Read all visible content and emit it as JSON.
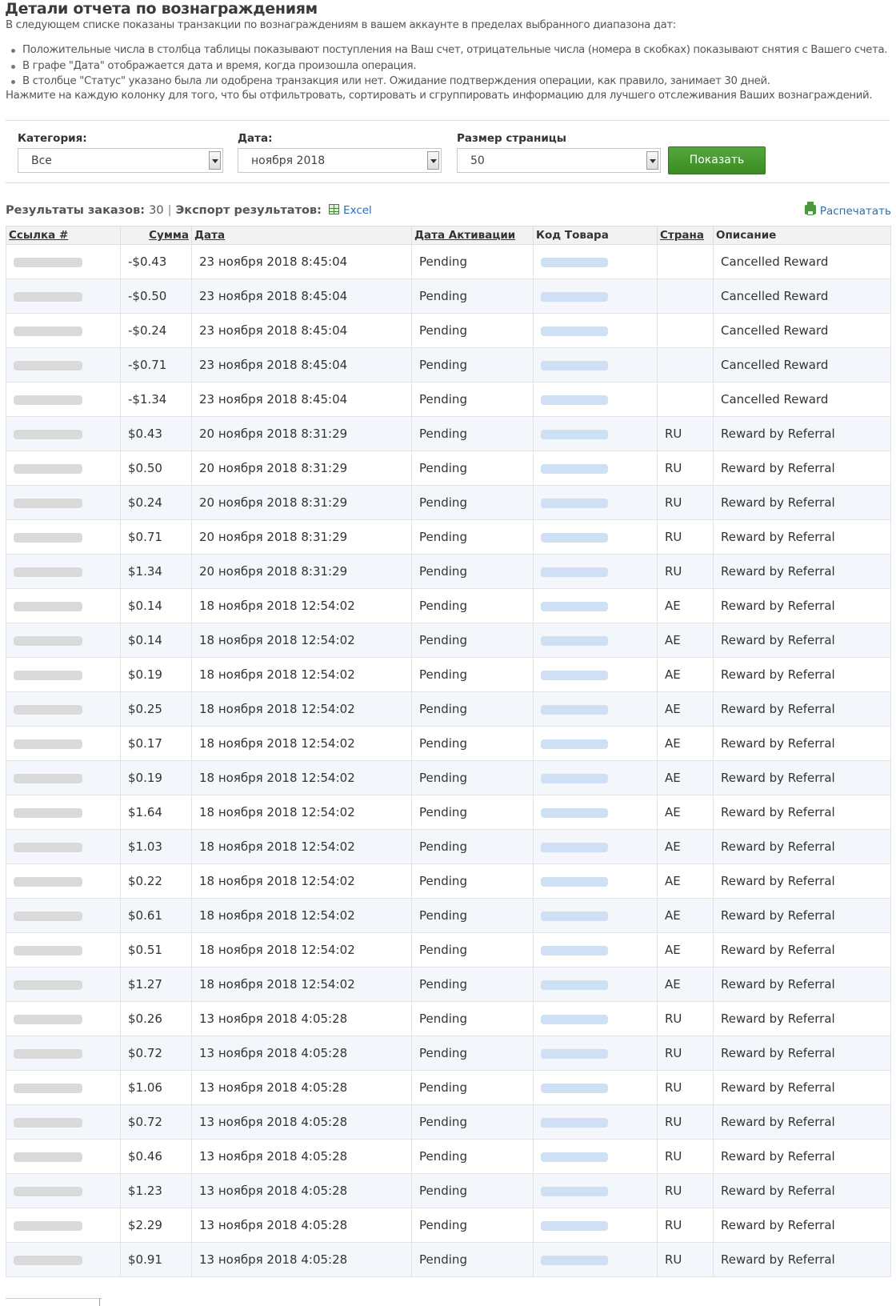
{
  "title": "Детали отчета по вознаграждениям",
  "intro": "В следующем списке показаны транзакции по вознаграждениям в вашем аккаунте в пределах выбранного диапазона дат:",
  "bullets": [
    "Положительные числа в столбца таблицы показывают поступления на Ваш счет, отрицательные числа (номера в скобках) показывают снятия с Вашего счета.",
    "В графе \"Дата\" отображается дата и время, когда произошла операция.",
    "В столбце \"Статус\" указано была ли одобрена транзакция или нет. Ожидание подтверждения операции, как правило, занимает 30 дней."
  ],
  "note": "Нажмите на каждую колонку для того, что бы отфильтровать, сортировать и сгруппировать информацию для лучшего отслеживания Ваших вознаграждений.",
  "filters": {
    "category_label": "Категория:",
    "category_value": "Все",
    "date_label": "Дата:",
    "date_value": "ноября 2018",
    "page_size_label": "Размер страницы",
    "page_size_value": "50",
    "show_button": "Показать"
  },
  "results": {
    "label": "Результаты заказов:",
    "count": "30",
    "separator": "|",
    "export_label": "Экспорт результатов:",
    "excel_link": "Excel",
    "print_link": "Распечатать"
  },
  "table": {
    "headers": {
      "ref": "Ссылка #",
      "amount": "Сумма",
      "date": "Дата",
      "activation": "Дата Активации",
      "product": "Код Товара",
      "country": "Страна",
      "description": "Описание"
    },
    "rows": [
      {
        "amount": "-$0.43",
        "date": "23 ноября 2018 8:45:04",
        "status": "Pending",
        "country": "",
        "desc": "Cancelled Reward"
      },
      {
        "amount": "-$0.50",
        "date": "23 ноября 2018 8:45:04",
        "status": "Pending",
        "country": "",
        "desc": "Cancelled Reward"
      },
      {
        "amount": "-$0.24",
        "date": "23 ноября 2018 8:45:04",
        "status": "Pending",
        "country": "",
        "desc": "Cancelled Reward"
      },
      {
        "amount": "-$0.71",
        "date": "23 ноября 2018 8:45:04",
        "status": "Pending",
        "country": "",
        "desc": "Cancelled Reward"
      },
      {
        "amount": "-$1.34",
        "date": "23 ноября 2018 8:45:04",
        "status": "Pending",
        "country": "",
        "desc": "Cancelled Reward"
      },
      {
        "amount": "$0.43",
        "date": "20 ноября 2018 8:31:29",
        "status": "Pending",
        "country": "RU",
        "desc": "Reward by Referral"
      },
      {
        "amount": "$0.50",
        "date": "20 ноября 2018 8:31:29",
        "status": "Pending",
        "country": "RU",
        "desc": "Reward by Referral"
      },
      {
        "amount": "$0.24",
        "date": "20 ноября 2018 8:31:29",
        "status": "Pending",
        "country": "RU",
        "desc": "Reward by Referral"
      },
      {
        "amount": "$0.71",
        "date": "20 ноября 2018 8:31:29",
        "status": "Pending",
        "country": "RU",
        "desc": "Reward by Referral"
      },
      {
        "amount": "$1.34",
        "date": "20 ноября 2018 8:31:29",
        "status": "Pending",
        "country": "RU",
        "desc": "Reward by Referral"
      },
      {
        "amount": "$0.14",
        "date": "18 ноября 2018 12:54:02",
        "status": "Pending",
        "country": "AE",
        "desc": "Reward by Referral"
      },
      {
        "amount": "$0.14",
        "date": "18 ноября 2018 12:54:02",
        "status": "Pending",
        "country": "AE",
        "desc": "Reward by Referral"
      },
      {
        "amount": "$0.19",
        "date": "18 ноября 2018 12:54:02",
        "status": "Pending",
        "country": "AE",
        "desc": "Reward by Referral"
      },
      {
        "amount": "$0.25",
        "date": "18 ноября 2018 12:54:02",
        "status": "Pending",
        "country": "AE",
        "desc": "Reward by Referral"
      },
      {
        "amount": "$0.17",
        "date": "18 ноября 2018 12:54:02",
        "status": "Pending",
        "country": "AE",
        "desc": "Reward by Referral"
      },
      {
        "amount": "$0.19",
        "date": "18 ноября 2018 12:54:02",
        "status": "Pending",
        "country": "AE",
        "desc": "Reward by Referral"
      },
      {
        "amount": "$1.64",
        "date": "18 ноября 2018 12:54:02",
        "status": "Pending",
        "country": "AE",
        "desc": "Reward by Referral"
      },
      {
        "amount": "$1.03",
        "date": "18 ноября 2018 12:54:02",
        "status": "Pending",
        "country": "AE",
        "desc": "Reward by Referral"
      },
      {
        "amount": "$0.22",
        "date": "18 ноября 2018 12:54:02",
        "status": "Pending",
        "country": "AE",
        "desc": "Reward by Referral"
      },
      {
        "amount": "$0.61",
        "date": "18 ноября 2018 12:54:02",
        "status": "Pending",
        "country": "AE",
        "desc": "Reward by Referral"
      },
      {
        "amount": "$0.51",
        "date": "18 ноября 2018 12:54:02",
        "status": "Pending",
        "country": "AE",
        "desc": "Reward by Referral"
      },
      {
        "amount": "$1.27",
        "date": "18 ноября 2018 12:54:02",
        "status": "Pending",
        "country": "AE",
        "desc": "Reward by Referral"
      },
      {
        "amount": "$0.26",
        "date": "13 ноября 2018 4:05:28",
        "status": "Pending",
        "country": "RU",
        "desc": "Reward by Referral"
      },
      {
        "amount": "$0.72",
        "date": "13 ноября 2018 4:05:28",
        "status": "Pending",
        "country": "RU",
        "desc": "Reward by Referral"
      },
      {
        "amount": "$1.06",
        "date": "13 ноября 2018 4:05:28",
        "status": "Pending",
        "country": "RU",
        "desc": "Reward by Referral"
      },
      {
        "amount": "$0.72",
        "date": "13 ноября 2018 4:05:28",
        "status": "Pending",
        "country": "RU",
        "desc": "Reward by Referral"
      },
      {
        "amount": "$0.46",
        "date": "13 ноября 2018 4:05:28",
        "status": "Pending",
        "country": "RU",
        "desc": "Reward by Referral"
      },
      {
        "amount": "$1.23",
        "date": "13 ноября 2018 4:05:28",
        "status": "Pending",
        "country": "RU",
        "desc": "Reward by Referral"
      },
      {
        "amount": "$2.29",
        "date": "13 ноября 2018 4:05:28",
        "status": "Pending",
        "country": "RU",
        "desc": "Reward by Referral"
      },
      {
        "amount": "$0.91",
        "date": "13 ноября 2018 4:05:28",
        "status": "Pending",
        "country": "RU",
        "desc": "Reward by Referral"
      }
    ]
  },
  "colors": {
    "accent_green": "#3a8b23",
    "link_blue": "#2a6ebb",
    "row_alt": "#f3f6fa"
  },
  "icons": {
    "excel": "excel-icon",
    "print": "printer-icon",
    "dropdown": "chevron-down-icon"
  }
}
